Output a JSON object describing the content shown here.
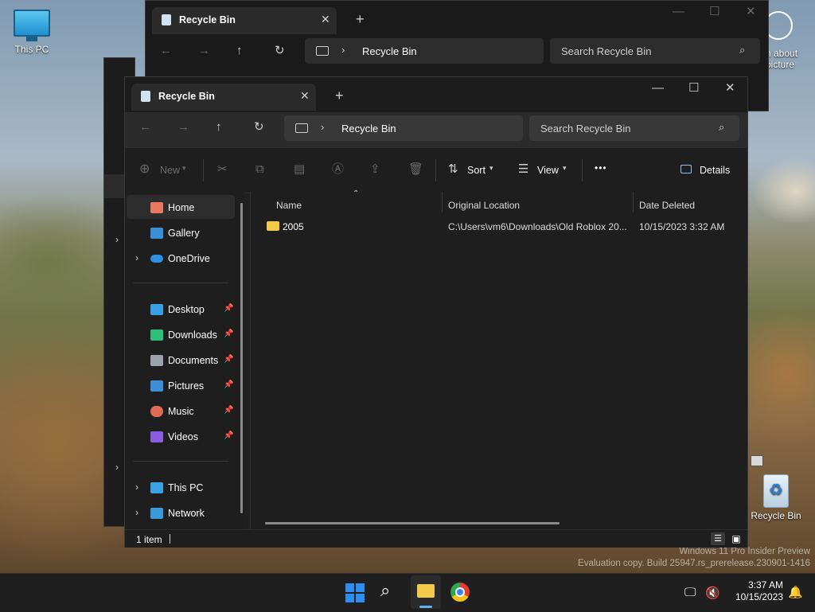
{
  "desktop": {
    "icons": [
      {
        "label": "This PC"
      },
      {
        "label": "Recycle Bin"
      }
    ],
    "partial_caption": [
      "n about",
      "picture"
    ],
    "watermark_line1": "Windows 11 Pro Insider Preview",
    "watermark_line2": "Evaluation copy. Build 25947.rs_prerelease.230901-1416"
  },
  "back_window": {
    "tab_title": "Recycle Bin",
    "breadcrumb": "Recycle Bin",
    "search_placeholder": "Search Recycle Bin"
  },
  "window": {
    "tab_title": "Recycle Bin",
    "new_tab": "+",
    "breadcrumb": "Recycle Bin",
    "search_placeholder": "Search Recycle Bin",
    "toolbar": {
      "new_label": "New",
      "sort_label": "Sort",
      "view_label": "View",
      "more_label": "•••",
      "details_label": "Details"
    },
    "sidebar": {
      "items": [
        {
          "label": "Home",
          "icon": "home-icon",
          "color": "#e8795e"
        },
        {
          "label": "Gallery",
          "icon": "gallery-icon",
          "color": "#3a8fd6"
        },
        {
          "label": "OneDrive",
          "icon": "cloud-icon",
          "color": "#2f8fe0"
        },
        {
          "label": "Desktop",
          "icon": "desktop-icon",
          "color": "#37a0e4"
        },
        {
          "label": "Downloads",
          "icon": "download-icon",
          "color": "#2fbf7a"
        },
        {
          "label": "Documents",
          "icon": "documents-icon",
          "color": "#9aa3ad"
        },
        {
          "label": "Pictures",
          "icon": "pictures-icon",
          "color": "#3d8fd8"
        },
        {
          "label": "Music",
          "icon": "music-icon",
          "color": "#e06b55"
        },
        {
          "label": "Videos",
          "icon": "videos-icon",
          "color": "#8b5be0"
        },
        {
          "label": "This PC",
          "icon": "computer-icon",
          "color": "#3aa3e6"
        },
        {
          "label": "Network",
          "icon": "network-icon",
          "color": "#3a9ad9"
        }
      ]
    },
    "columns": [
      "Name",
      "Original Location",
      "Date Deleted"
    ],
    "rows": [
      {
        "name": "2005",
        "location": "C:\\Users\\vm6\\Downloads\\Old Roblox 20...",
        "date": "10/15/2023 3:32 AM"
      }
    ],
    "status": "1 item"
  },
  "taskbar": {
    "time": "3:37 AM",
    "date": "10/15/2023"
  }
}
